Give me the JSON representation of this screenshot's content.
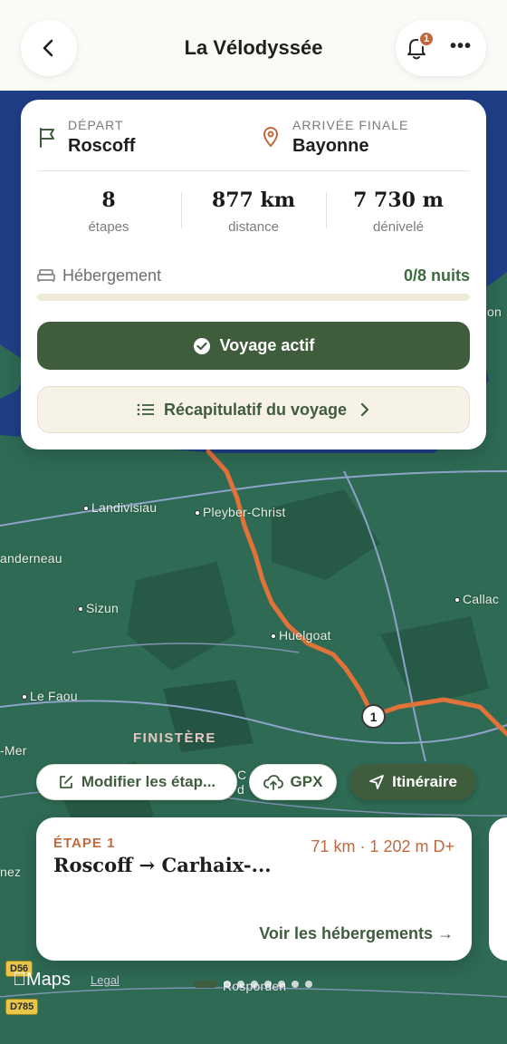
{
  "header": {
    "title": "La Vélodyssée",
    "notification_count": "1",
    "more_label": "•••"
  },
  "summary": {
    "depart_label": "DÉPART",
    "depart_value": "Roscoff",
    "arrival_label": "ARRIVÉE FINALE",
    "arrival_value": "Bayonne",
    "stats": [
      {
        "value": "8",
        "label": "étapes"
      },
      {
        "value": "877 km",
        "label": "distance"
      },
      {
        "value": "7 730 m",
        "label": "dénivelé"
      }
    ],
    "lodging_label": "Hébergement",
    "lodging_value": "0/8 nuits",
    "lodging_progress": 0,
    "active_button": "Voyage actif",
    "recap_button": "Récapitulatif du voyage"
  },
  "map": {
    "places": [
      "Landivisiau",
      "Pleyber-Christ",
      "anderneau",
      "Sizun",
      "Huelgoat",
      "Callac",
      "Le Faou",
      "-Mer",
      "nez",
      "on",
      "Rosporden",
      "C",
      "d"
    ],
    "region": "FINISTÈRE",
    "road_badges": [
      "D56",
      "D785"
    ],
    "waypoint": "1",
    "maps_label": "Maps",
    "legal_label": "Legal"
  },
  "actions": {
    "edit_steps": "Modifier les étap...",
    "gpx": "GPX",
    "itinerary": "Itinéraire"
  },
  "stage": {
    "tag": "ÉTAPE 1",
    "meta": "71 km · 1 202 m D+",
    "title": "Roscoff → Carhaix-...",
    "link": "Voir les hébergements →"
  },
  "colors": {
    "accent_green": "#3f5d3c",
    "accent_orange": "#c0683e",
    "route": "#e0723a"
  }
}
